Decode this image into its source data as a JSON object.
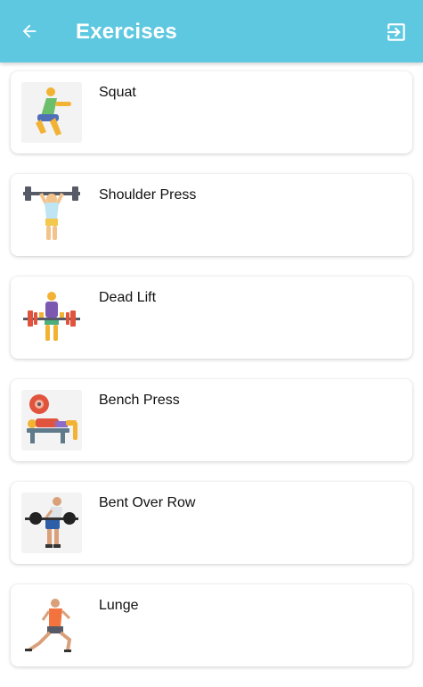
{
  "header": {
    "title": "Exercises",
    "back_icon": "arrow-left-icon",
    "exit_icon": "exit-to-app-icon",
    "background": "#5ec8e0"
  },
  "exercises": [
    {
      "name": "Squat",
      "icon": "squat-illustration"
    },
    {
      "name": "Shoulder Press",
      "icon": "shoulder-press-illustration"
    },
    {
      "name": "Dead Lift",
      "icon": "deadlift-illustration"
    },
    {
      "name": "Bench Press",
      "icon": "bench-press-illustration"
    },
    {
      "name": "Bent Over Row",
      "icon": "bent-over-row-illustration"
    },
    {
      "name": "Lunge",
      "icon": "lunge-illustration"
    }
  ]
}
